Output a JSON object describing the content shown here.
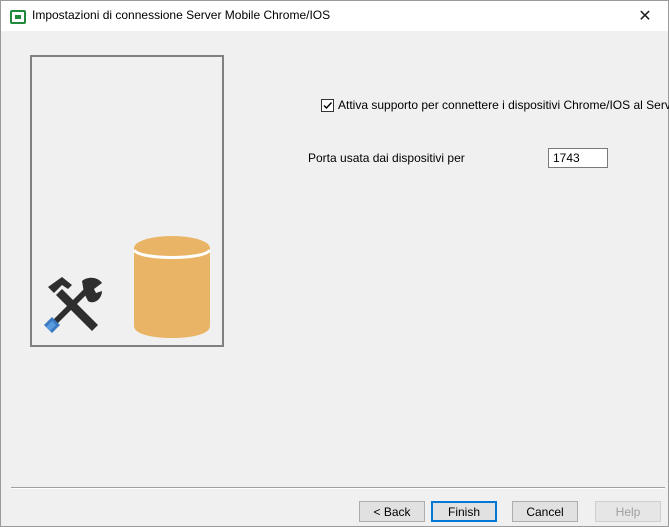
{
  "window": {
    "title": "Impostazioni di connessione Server Mobile Chrome/IOS",
    "close_glyph": "✕"
  },
  "settings": {
    "enable_checkbox_label": "Attiva supporto per connettere i dispositivi Chrome/IOS al Server",
    "enable_checked": true,
    "port_label": "Porta usata dai dispositivi per",
    "port_value": "1743"
  },
  "buttons": {
    "back": "< Back",
    "finish": "Finish",
    "cancel": "Cancel",
    "help": "Help"
  },
  "icons": {
    "app": "app-window-icon",
    "tools": "wrench-hammer-icon",
    "database": "database-cylinder-icon"
  },
  "colors": {
    "database": "#eab466",
    "database_top": "#eab466",
    "default_button_border": "#0078d7",
    "app_icon": "#1f8a3a"
  }
}
